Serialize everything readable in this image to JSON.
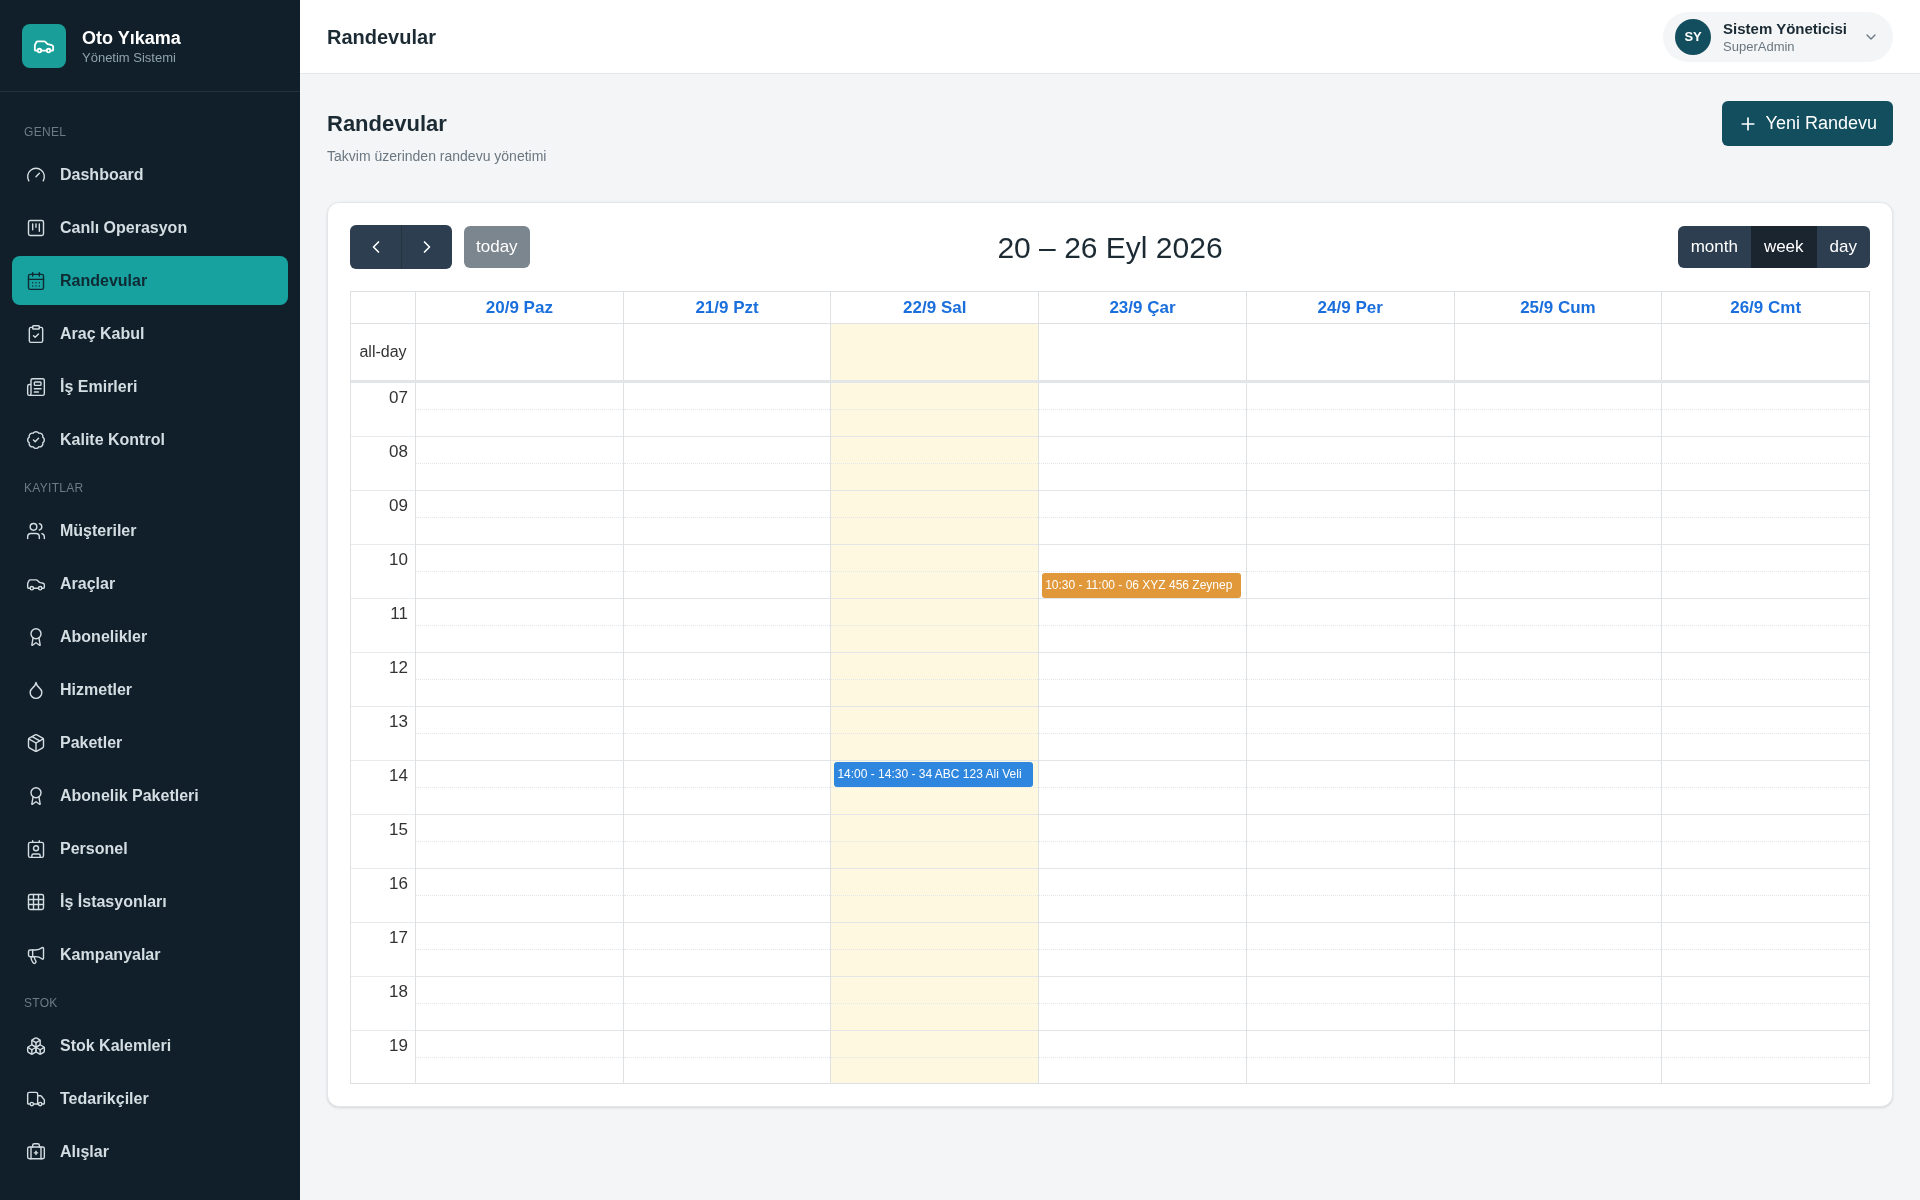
{
  "brand": {
    "title": "Oto Yıkama",
    "subtitle": "Yönetim Sistemi"
  },
  "sidebar": [
    {
      "label": "GENEL",
      "items": [
        {
          "label": "Dashboard",
          "selected": false
        },
        {
          "label": "Canlı Operasyon",
          "selected": false
        },
        {
          "label": "Randevular",
          "selected": true
        },
        {
          "label": "Araç Kabul",
          "selected": false
        },
        {
          "label": "İş Emirleri",
          "selected": false
        },
        {
          "label": "Kalite Kontrol",
          "selected": false
        }
      ]
    },
    {
      "label": "KAYITLAR",
      "items": [
        {
          "label": "Müşteriler",
          "selected": false
        },
        {
          "label": "Araçlar",
          "selected": false
        },
        {
          "label": "Abonelikler",
          "selected": false
        },
        {
          "label": "Hizmetler",
          "selected": false
        },
        {
          "label": "Paketler",
          "selected": false
        },
        {
          "label": "Abonelik Paketleri",
          "selected": false
        },
        {
          "label": "Personel",
          "selected": false
        },
        {
          "label": "İş İstasyonları",
          "selected": false
        },
        {
          "label": "Kampanyalar",
          "selected": false
        }
      ]
    },
    {
      "label": "STOK",
      "items": [
        {
          "label": "Stok Kalemleri",
          "selected": false
        },
        {
          "label": "Tedarikçiler",
          "selected": false
        },
        {
          "label": "Alışlar",
          "selected": false
        }
      ]
    }
  ],
  "header": {
    "title": "Randevular",
    "user": {
      "initials": "SY",
      "name": "Sistem Yöneticisi",
      "role": "SuperAdmin"
    }
  },
  "page": {
    "title": "Randevular",
    "subtitle": "Takvim üzerinden randevu yönetimi",
    "new_button": "Yeni Randevu"
  },
  "calendar": {
    "today_button": "today",
    "title": "20 – 26 Eyl 2026",
    "views": [
      {
        "label": "month",
        "selected": false
      },
      {
        "label": "week",
        "selected": true
      },
      {
        "label": "day",
        "selected": false
      }
    ],
    "all_day_label": "all-day",
    "days": [
      {
        "label": "20/9 Paz",
        "today": false
      },
      {
        "label": "21/9 Pzt",
        "today": false
      },
      {
        "label": "22/9 Sal",
        "today": true,
        "events": [
          {
            "text": "14:00 - 14:30 - 34 ABC 123 Ali Veli",
            "color": "#2e86de"
          }
        ]
      },
      {
        "label": "23/9 Çar",
        "today": false,
        "events": [
          {
            "text": "10:30 - 11:00 - 06 XYZ 456 Zeynep",
            "color": "#e0983a"
          }
        ]
      },
      {
        "label": "24/9 Per",
        "today": false
      },
      {
        "label": "25/9 Cum",
        "today": false
      },
      {
        "label": "26/9 Cmt",
        "today": false
      }
    ],
    "hours": [
      "07",
      "08",
      "09",
      "10",
      "11",
      "12",
      "13",
      "14",
      "15",
      "16",
      "17",
      "18",
      "19"
    ]
  }
}
